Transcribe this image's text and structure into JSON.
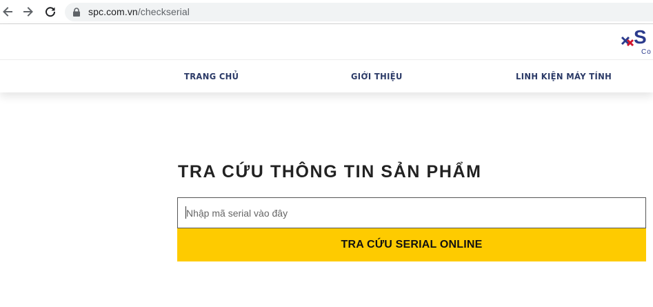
{
  "browser": {
    "url_host": "spc.com.vn",
    "url_path": "/checkserial"
  },
  "logo": {
    "letter": "S",
    "subtext": "Co"
  },
  "nav": {
    "home": "TRANG CHỦ",
    "about": "GIỚI THIỆU",
    "parts": "LINH KIỆN MÁY TÍNH"
  },
  "main": {
    "title": "TRA CỨU THÔNG TIN SẢN PHẨM",
    "serial_placeholder": "Nhập mã serial vào đây",
    "submit_label": "TRA CỨU SERIAL ONLINE"
  },
  "colors": {
    "accent_yellow": "#fecb00",
    "nav_text": "#2b3a67",
    "brand_blue": "#2a3a8c",
    "brand_red": "#d0142c"
  }
}
